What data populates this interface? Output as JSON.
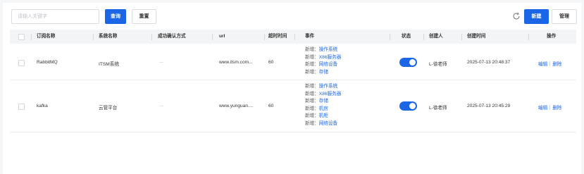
{
  "toolbar": {
    "search_placeholder": "请输入关键字",
    "query_label": "查询",
    "reset_label": "重置",
    "new_label": "新建",
    "manage_label": "管理"
  },
  "table": {
    "columns": [
      "订阅名称",
      "系统名称",
      "成功确认方式",
      "url",
      "超时时间",
      "事件",
      "状态",
      "创建人",
      "创建时间",
      "操作"
    ],
    "rows": [
      {
        "name": "RabbitMQ",
        "system": "ITSM系统",
        "confirm": "—",
        "url": "www.itsm.com...",
        "timeout": "60",
        "event_prefix": "新增：",
        "events": [
          "操作系统",
          "X86服务器",
          "网络设备",
          "存储"
        ],
        "status": "on",
        "creator": "L-徐老师",
        "created": "2025-07-13 20:48:37",
        "edit": "编辑",
        "delete": "删除"
      },
      {
        "name": "kafka",
        "system": "云管平台",
        "confirm": "—",
        "url": "www.yunguan....",
        "timeout": "60",
        "event_prefix": "新增：",
        "events": [
          "操作系统",
          "X86服务器",
          "存储",
          "机房",
          "机柜",
          "网络设备"
        ],
        "status": "on",
        "creator": "L-徐老师",
        "created": "2025-07-13 20:45:29",
        "edit": "编辑",
        "delete": "删除"
      }
    ]
  },
  "colors": {
    "primary": "#1a66e6",
    "header_bg": "#f3f4f6",
    "page_bg": "#f5f6f8"
  }
}
